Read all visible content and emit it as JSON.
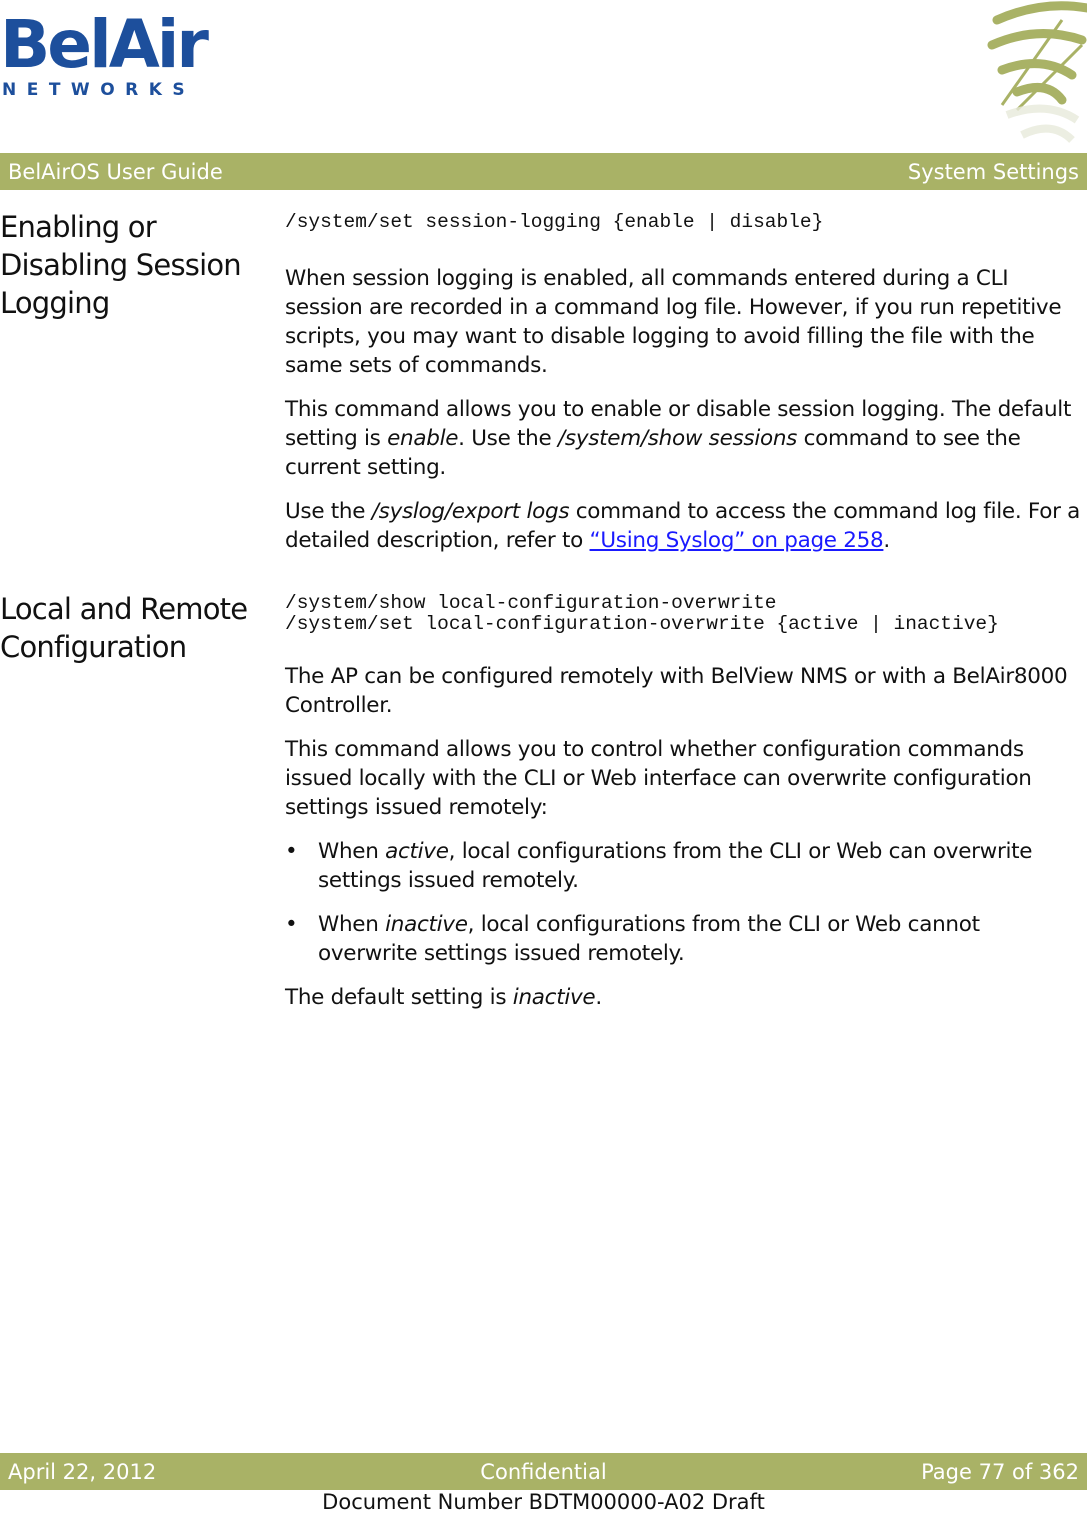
{
  "logo": {
    "main": "BelAir",
    "sub": "NETWORKS"
  },
  "header": {
    "left": "BelAirOS User Guide",
    "right": "System Settings"
  },
  "colors": {
    "bar": "#a9b266",
    "logo_blue": "#1d4f9c",
    "link": "#1a1aff"
  },
  "sections": [
    {
      "title_lines": [
        "Enabling or",
        "Disabling Session",
        "Logging"
      ],
      "code": [
        "/system/set session-logging {enable | disable}"
      ],
      "p1": "When session logging is enabled, all commands entered during a CLI session are recorded in a command log file. However, if you run repetitive scripts, you may want to disable logging to avoid filling the file with the same sets of commands.",
      "p2": {
        "a": "This command allows you to enable or disable session logging. The default setting is ",
        "b": "enable",
        "c": ". Use the ",
        "d": "/system/show sessions",
        "e": " command to see the current setting."
      },
      "p3": {
        "a": "Use the ",
        "b": "/syslog/export logs",
        "c": " command to access the command log file. For a detailed description, refer to ",
        "link": "“Using Syslog” on page 258",
        "d": "."
      }
    },
    {
      "title_lines": [
        "Local and Remote",
        "Configuration"
      ],
      "code": [
        "/system/show local-configuration-overwrite",
        "/system/set local-configuration-overwrite {active | inactive}"
      ],
      "p1": "The AP can be configured remotely with BelView NMS or with a BelAir8000 Controller.",
      "p2": "This command allows you to control whether configuration commands issued locally with the CLI or Web interface can overwrite configuration settings issued remotely:",
      "bullets": [
        {
          "a": "When ",
          "b": "active",
          "c": ", local configurations from the CLI or Web can overwrite settings issued remotely."
        },
        {
          "a": "When ",
          "b": "inactive",
          "c": ", local configurations from the CLI or Web cannot overwrite settings issued remotely."
        }
      ],
      "p3": {
        "a": "The default setting is ",
        "b": "inactive",
        "c": "."
      }
    }
  ],
  "footer": {
    "left": "April 22, 2012",
    "center": "Confidential",
    "right": "Page 77 of 362",
    "doc_number": "Document Number BDTM00000-A02 Draft"
  },
  "bullet_char": "•"
}
